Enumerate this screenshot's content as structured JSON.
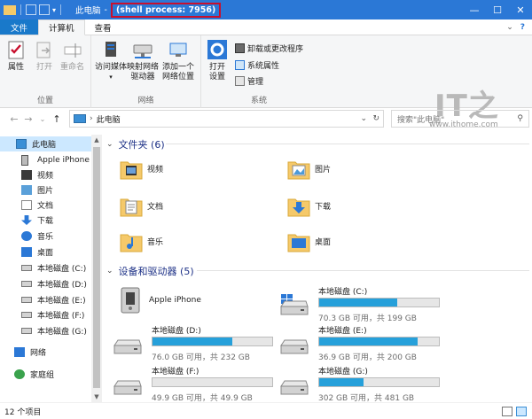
{
  "titlebar": {
    "title": "此电脑",
    "separator": "-",
    "process": "(shell process: 7956)",
    "minimize": "—",
    "maximize": "☐",
    "close": "✕"
  },
  "tabs": {
    "file": "文件",
    "computer": "计算机",
    "view": "查看"
  },
  "ribbon": {
    "location": {
      "label": "位置",
      "properties": "属性",
      "open": "打开",
      "rename": "重命名"
    },
    "network": {
      "label": "网络",
      "access_media": "访问媒体",
      "map_drive_1": "映射网络",
      "map_drive_2": "驱动器",
      "add_location_1": "添加一个",
      "add_location_2": "网络位置"
    },
    "system": {
      "label": "系统",
      "open_settings_1": "打开",
      "open_settings_2": "设置",
      "uninstall": "卸载或更改程序",
      "system_props": "系统属性",
      "manage": "管理"
    }
  },
  "watermark": {
    "logo": "IT之家",
    "url": "www.ithome.com"
  },
  "address": {
    "path": "此电脑",
    "search_placeholder": "搜索\"此电脑\""
  },
  "nav": {
    "items": [
      {
        "label": "此电脑",
        "icon": "pc-icon"
      },
      {
        "label": "Apple iPhone",
        "icon": "phone-icon"
      },
      {
        "label": "视频",
        "icon": "video-icon"
      },
      {
        "label": "图片",
        "icon": "picture-icon"
      },
      {
        "label": "文档",
        "icon": "document-icon"
      },
      {
        "label": "下载",
        "icon": "download-icon"
      },
      {
        "label": "音乐",
        "icon": "music-icon"
      },
      {
        "label": "桌面",
        "icon": "desktop-icon"
      },
      {
        "label": "本地磁盘 (C:)",
        "icon": "drive-icon"
      },
      {
        "label": "本地磁盘 (D:)",
        "icon": "drive-icon"
      },
      {
        "label": "本地磁盘 (E:)",
        "icon": "drive-icon"
      },
      {
        "label": "本地磁盘 (F:)",
        "icon": "drive-icon"
      },
      {
        "label": "本地磁盘 (G:)",
        "icon": "drive-icon"
      },
      {
        "label": "网络",
        "icon": "network-icon"
      },
      {
        "label": "家庭组",
        "icon": "homegroup-icon"
      }
    ]
  },
  "content": {
    "folders_header": "文件夹 (6)",
    "devices_header": "设备和驱动器 (5)",
    "folders": [
      {
        "label": "视频",
        "icon": "video-folder-icon"
      },
      {
        "label": "图片",
        "icon": "picture-folder-icon"
      },
      {
        "label": "文档",
        "icon": "document-folder-icon"
      },
      {
        "label": "下载",
        "icon": "download-folder-icon"
      },
      {
        "label": "音乐",
        "icon": "music-folder-icon"
      },
      {
        "label": "桌面",
        "icon": "desktop-folder-icon"
      }
    ],
    "iphone": "Apple iPhone",
    "drives": [
      {
        "name": "本地磁盘 (C:)",
        "info": "70.3 GB 可用，共 199 GB",
        "used_fraction": 0.65,
        "system": true
      },
      {
        "name": "本地磁盘 (D:)",
        "info": "76.0 GB 可用，共 232 GB",
        "used_fraction": 0.67,
        "system": false
      },
      {
        "name": "本地磁盘 (E:)",
        "info": "36.9 GB 可用，共 200 GB",
        "used_fraction": 0.82,
        "system": false
      },
      {
        "name": "本地磁盘 (F:)",
        "info": "49.9 GB 可用，共 49.9 GB",
        "used_fraction": 0.0,
        "system": false
      },
      {
        "name": "本地磁盘 (G:)",
        "info": "302 GB 可用，共 481 GB",
        "used_fraction": 0.37,
        "system": false
      }
    ]
  },
  "status": {
    "count": "12 个项目"
  },
  "colors": {
    "accent": "#2b78d6",
    "bar_fill": "#26a0da",
    "header_text": "#1e3287",
    "highlight": "#c8102e"
  }
}
